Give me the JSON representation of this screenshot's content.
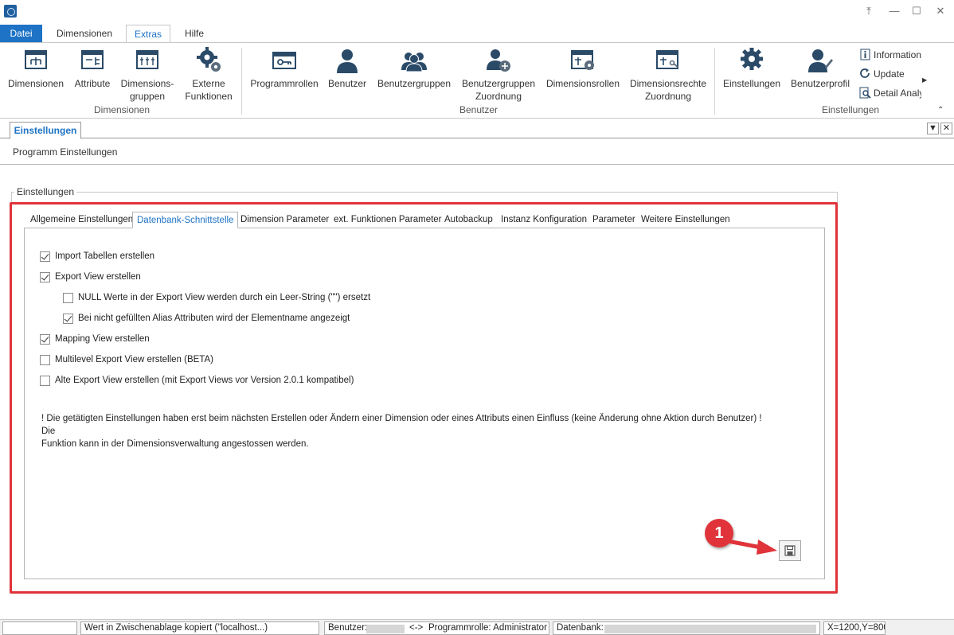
{
  "window": {
    "controls": [
      "restore-down",
      "minimize",
      "maximize",
      "close"
    ]
  },
  "ribbon": {
    "file_tab": "Datei",
    "tabs": [
      "Dimensionen",
      "Extras",
      "Hilfe"
    ],
    "active_tab": "Extras",
    "groups": {
      "dimensionen": {
        "label": "Dimensionen",
        "buttons": [
          {
            "label": "Dimensionen",
            "icon": "dimension-tree-icon"
          },
          {
            "label": "Attribute",
            "icon": "attribute-icon"
          },
          {
            "label_line1": "Dimensions-",
            "label_line2": "gruppen",
            "icon": "dimension-groups-icon"
          },
          {
            "label_line1": "Externe",
            "label_line2": "Funktionen",
            "icon": "external-functions-gear-icon"
          }
        ]
      },
      "benutzer": {
        "label": "Benutzer",
        "buttons": [
          {
            "label": "Programmrollen",
            "icon": "program-roles-key-icon"
          },
          {
            "label": "Benutzer",
            "icon": "user-icon"
          },
          {
            "label": "Benutzergruppen",
            "icon": "user-groups-icon"
          },
          {
            "label_line1": "Benutzergruppen",
            "label_line2": "Zuordnung",
            "icon": "user-group-assignment-icon"
          },
          {
            "label": "Dimensionsrollen",
            "icon": "dimension-roles-icon"
          },
          {
            "label_line1": "Dimensionsrechte",
            "label_line2": "Zuordnung",
            "icon": "dimension-rights-icon"
          }
        ]
      },
      "einstellungen": {
        "label": "Einstellungen",
        "buttons": [
          {
            "label": "Einstellungen",
            "icon": "settings-gear-icon"
          },
          {
            "label": "Benutzerprofil",
            "icon": "user-profile-icon"
          }
        ],
        "small_buttons": [
          {
            "label": "Information",
            "icon": "info-icon"
          },
          {
            "label": "Update",
            "icon": "refresh-icon"
          },
          {
            "label": "Detail Analy",
            "icon": "search-document-icon"
          }
        ]
      }
    }
  },
  "document": {
    "tab_title": "Einstellungen",
    "subtitle": "Programm Einstellungen",
    "groupbox_title": "Einstellungen",
    "inner_tabs": [
      "Allgemeine Einstellungen",
      "Datenbank-Schnittstelle",
      "Dimension Parameter",
      "ext. Funktionen Parameter",
      "Autobackup",
      "Instanz Konfiguration",
      "Parameter",
      "Weitere Einstellungen"
    ],
    "active_inner_tab": "Datenbank-Schnittstelle",
    "options": [
      {
        "label": "Import Tabellen erstellen",
        "checked": true
      },
      {
        "label": "Export View erstellen",
        "checked": true
      },
      {
        "label": "NULL Werte in der Export View werden durch ein Leer-String (\"\") ersetzt",
        "checked": false
      },
      {
        "label": "Bei nicht gefüllten Alias Attributen wird der Elementname angezeigt",
        "checked": true
      },
      {
        "label": "Mapping View erstellen",
        "checked": true
      },
      {
        "label": "Multilevel Export View erstellen (BETA)",
        "checked": false
      },
      {
        "label": "Alte Export View erstellen (mit Export Views vor Version 2.0.1 kompatibel)",
        "checked": false
      }
    ],
    "note_line1": "! Die getätigten Einstellungen haben erst beim nächsten Erstellen oder Ändern einer Dimension oder eines Attributs einen Einfluss (keine Änderung ohne Aktion durch Benutzer) ! Die",
    "note_line2": "Funktion kann in der Dimensionsverwaltung angestossen werden.",
    "callout_number": "1"
  },
  "statusbar": {
    "message": "Wert in Zwischenablage kopiert (\"localhost...)",
    "user_label": "Benutzer:",
    "separator": "<->",
    "role": "Programmrolle: Administrator",
    "db_label": "Datenbank:",
    "coords": "X=1200,Y=800"
  },
  "colors": {
    "accent": "#1e73c6",
    "highlight_red": "#e0343a",
    "icon_dark": "#2a4a68"
  }
}
